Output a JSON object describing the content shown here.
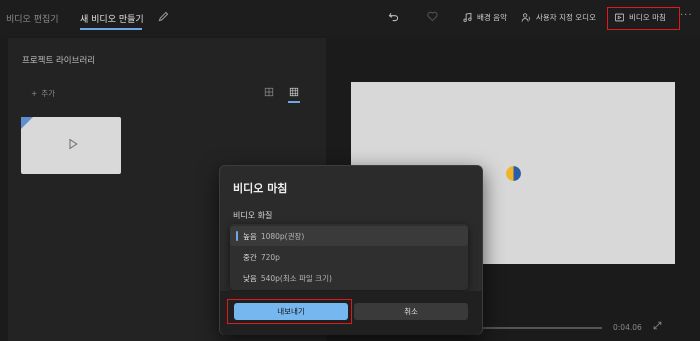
{
  "topbar": {
    "crumb_editor": "비디오 편집기",
    "crumb_new": "새 비디오 만들기",
    "bg_music": "배경 음악",
    "custom_audio": "사용자 지정 오디오",
    "finish_video": "비디오 마침",
    "more": "···"
  },
  "library": {
    "title": "프로젝트 라이브러리",
    "add": "추가"
  },
  "player": {
    "time": "0:04.06"
  },
  "dialog": {
    "title": "비디오 마침",
    "quality_label": "비디오 화질",
    "options": [
      {
        "name": "높음",
        "detail": "1080p(권장)"
      },
      {
        "name": "중간",
        "detail": "720p"
      },
      {
        "name": "낮음",
        "detail": "540p(최소 파일 크기)"
      }
    ],
    "export_label": "내보내기",
    "cancel_label": "취소"
  },
  "colors": {
    "accent": "#77b7ef",
    "highlight": "#e01a1a"
  }
}
